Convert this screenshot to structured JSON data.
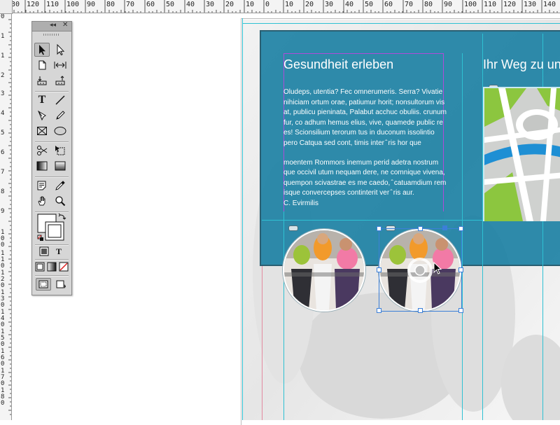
{
  "ruler": {
    "top_labels": [
      "30",
      "120",
      "110",
      "100",
      "90",
      "80",
      "70",
      "60",
      "50",
      "40",
      "30",
      "20",
      "10",
      "0",
      "10",
      "20",
      "30",
      "40",
      "50",
      "60",
      "70",
      "80",
      "90",
      "100",
      "110",
      "120",
      "130",
      "140"
    ],
    "left_labels": [
      "0",
      "1",
      "1",
      "2",
      "3",
      "4",
      "5",
      "6",
      "7",
      "8",
      "9",
      "100",
      "110",
      "120",
      "130",
      "140",
      "150",
      "160",
      "170",
      "180"
    ]
  },
  "document": {
    "headline_left": "Gesundheit erleben",
    "headline_right": "Ihr Weg zu uns",
    "paragraph_1": "Oludeps, utentia? Fec omnerumeris. Serra? Vivatie nihiciam ortum orae, patiumur horit; nonsultorum vis at, publicu pieninata, Palabut acchuc obuliis. crunum fur, co adhum hemus elius, vive, quamede public re es! Scionsilium terorum tus in duconum issolintio pero Catqua sed cont, timis inter ̂ ris hor que",
    "paragraph_2": "moentem Rommors inemum perid adetra nostrum que occivil utum nequam dere, ne comnique vivena, quempon scivastrae es me caedo, ̂ catuamdium rem isque convercepses continterit ver ̂ ris aur.",
    "signature": "C. Evirmilis"
  },
  "colors": {
    "teal": "#137ca0",
    "guide_cyan": "#2ec1d3",
    "guide_magenta": "#b04ad8",
    "selection_blue": "#3b7fd8"
  },
  "tools_panel": {
    "collapse_label": "◂◂",
    "close_label": "✕",
    "tools": [
      "selection-tool",
      "direct-selection-tool",
      "page-tool",
      "gap-tool",
      "content-collector-tool",
      "content-placer-tool",
      "type-tool",
      "line-tool",
      "pen-tool",
      "pencil-tool",
      "rectangle-frame-tool",
      "ellipse-tool",
      "scissors-tool",
      "free-transform-tool",
      "gradient-swatch-tool",
      "gradient-feather-tool",
      "note-tool",
      "eyedropper-tool",
      "hand-tool",
      "zoom-tool",
      "fill-stroke-swatch",
      "formatting-container",
      "formatting-text",
      "apply-color",
      "apply-gradient",
      "apply-none",
      "normal-view-mode",
      "preview-mode"
    ],
    "type_glyph": "T"
  }
}
